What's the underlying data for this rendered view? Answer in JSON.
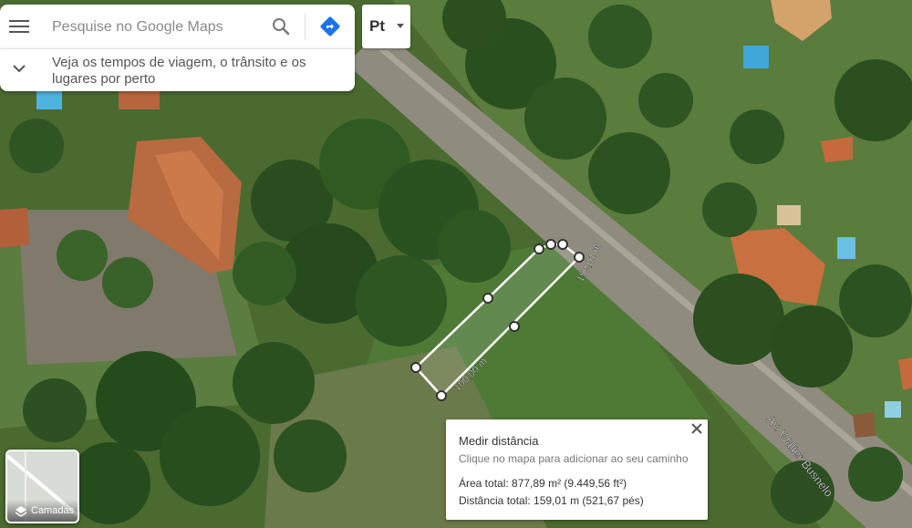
{
  "search": {
    "placeholder": "Pesquise no Google Maps",
    "suggestion": "Veja os tempos de viagem, o trânsito e os lugares por perto"
  },
  "pegman": {
    "label": "Pt"
  },
  "layers": {
    "label": "Camadas"
  },
  "measure": {
    "title": "Medir distância",
    "hint": "Clique no mapa para adicionar ao seu caminho",
    "area": "Área total: 877,89 m² (9.449,56 ft²)",
    "distance": "Distância total: 159,01 m (521,67 pés)"
  },
  "map_labels": {
    "segment_long": "159,01 m",
    "segment_short": "100,00 m",
    "street": "Av. Walter Busnelo"
  },
  "colors": {
    "accent": "#1a73e8",
    "measure_line": "#ffffff",
    "vegetation": "#2f5a22",
    "road": "#8f8c7f"
  }
}
